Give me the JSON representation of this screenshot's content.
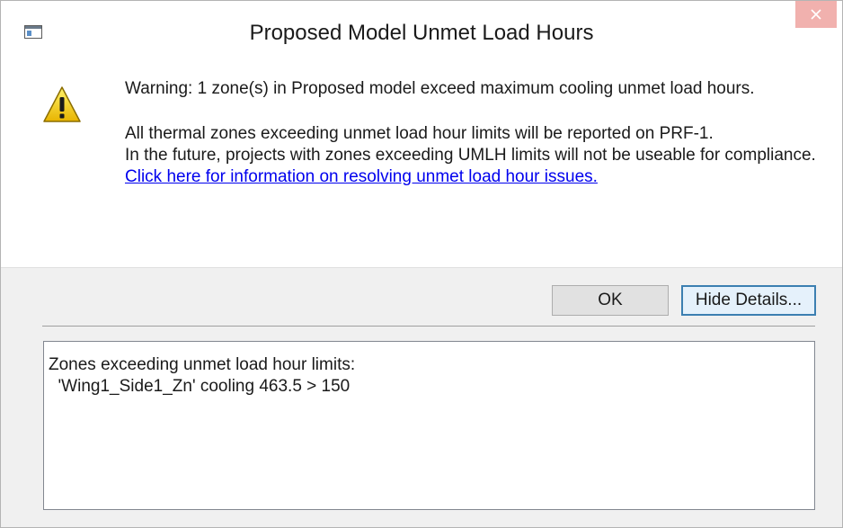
{
  "window": {
    "title": "Proposed Model Unmet Load Hours",
    "icons": {
      "app": "window-app-icon",
      "close": "close-icon",
      "warning": "warning-icon"
    },
    "close_color": "#f1b1ae"
  },
  "message": {
    "line1": "Warning: 1 zone(s) in Proposed model exceed maximum cooling unmet load hours.",
    "line2": "All thermal zones exceeding unmet load hour limits will be reported on PRF-1.",
    "line3": "In the future, projects with zones exceeding UMLH limits will not be useable for compliance.",
    "link": "Click here for information on resolving unmet load hour issues."
  },
  "buttons": {
    "ok": "OK",
    "hide_details": "Hide Details..."
  },
  "details": {
    "text": "Zones exceeding unmet load hour limits:\n  'Wing1_Side1_Zn' cooling 463.5 > 150"
  }
}
